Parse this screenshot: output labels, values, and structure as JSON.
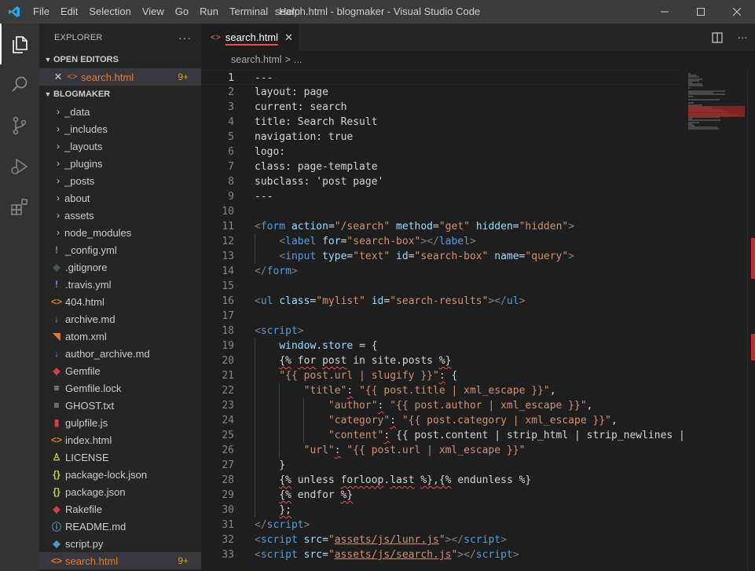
{
  "window": {
    "title": "search.html - blogmaker - Visual Studio Code",
    "menu": [
      "File",
      "Edit",
      "Selection",
      "View",
      "Go",
      "Run",
      "Terminal",
      "Help"
    ]
  },
  "sidebar": {
    "title": "EXPLORER",
    "more": "···",
    "open_editors_label": "OPEN EDITORS",
    "open_editor": {
      "name": "search.html",
      "badge": "9+"
    },
    "project_label": "BLOGMAKER",
    "folders": [
      "_data",
      "_includes",
      "_layouts",
      "_plugins",
      "_posts",
      "about",
      "assets",
      "node_modules"
    ],
    "files": [
      {
        "name": "_config.yml",
        "icon": "!",
        "color": "#a074c4"
      },
      {
        "name": ".gitignore",
        "icon": "◆",
        "color": "#41535b"
      },
      {
        "name": ".travis.yml",
        "icon": "!",
        "color": "#a074c4"
      },
      {
        "name": "404.html",
        "icon": "<>",
        "color": "#e37933"
      },
      {
        "name": "archive.md",
        "icon": "↓",
        "color": "#519aba"
      },
      {
        "name": "atom.xml",
        "icon": "◥",
        "color": "#e37933"
      },
      {
        "name": "author_archive.md",
        "icon": "↓",
        "color": "#519aba"
      },
      {
        "name": "Gemfile",
        "icon": "◆",
        "color": "#cc3e44"
      },
      {
        "name": "Gemfile.lock",
        "icon": "≡",
        "color": "#cccccc"
      },
      {
        "name": "GHOST.txt",
        "icon": "≡",
        "color": "#cccccc"
      },
      {
        "name": "gulpfile.js",
        "icon": "▮",
        "color": "#cc3e44"
      },
      {
        "name": "index.html",
        "icon": "<>",
        "color": "#e37933"
      },
      {
        "name": "LICENSE",
        "icon": "♙",
        "color": "#cbcb41"
      },
      {
        "name": "package-lock.json",
        "icon": "{}",
        "color": "#cbcb41"
      },
      {
        "name": "package.json",
        "icon": "{}",
        "color": "#cbcb41"
      },
      {
        "name": "Rakefile",
        "icon": "◆",
        "color": "#cc3e44"
      },
      {
        "name": "README.md",
        "icon": "ⓘ",
        "color": "#519aba"
      },
      {
        "name": "script.py",
        "icon": "◆",
        "color": "#519aba"
      },
      {
        "name": "search.html",
        "icon": "<>",
        "color": "#e37933",
        "badge": "9+",
        "selected": true
      }
    ]
  },
  "editor": {
    "tab_label": "search.html",
    "breadcrumb": [
      "search.html",
      "..."
    ],
    "breadcrumb_sep": ">",
    "active_line": 1,
    "lines": [
      [
        [
          "p",
          "---"
        ]
      ],
      [
        [
          "p",
          "layout: page"
        ]
      ],
      [
        [
          "p",
          "current: search"
        ]
      ],
      [
        [
          "p",
          "title: Search Result"
        ]
      ],
      [
        [
          "p",
          "navigation: true"
        ]
      ],
      [
        [
          "p",
          "logo:"
        ]
      ],
      [
        [
          "p",
          "class: page-template"
        ]
      ],
      [
        [
          "p",
          "subclass: 'post page'"
        ]
      ],
      [
        [
          "p",
          "---"
        ]
      ],
      [],
      [
        [
          "b",
          "<"
        ],
        [
          "t",
          "form"
        ],
        [
          "p",
          " "
        ],
        [
          "a",
          "action"
        ],
        [
          "p",
          "="
        ],
        [
          "s",
          "\"/search\""
        ],
        [
          "p",
          " "
        ],
        [
          "a",
          "method"
        ],
        [
          "p",
          "="
        ],
        [
          "s",
          "\"get\""
        ],
        [
          "p",
          " "
        ],
        [
          "a",
          "hidden"
        ],
        [
          "p",
          "="
        ],
        [
          "s",
          "\"hidden\""
        ],
        [
          "b",
          ">"
        ]
      ],
      [
        [
          "p",
          "    "
        ],
        [
          "b",
          "<"
        ],
        [
          "t",
          "label"
        ],
        [
          "p",
          " "
        ],
        [
          "a",
          "for"
        ],
        [
          "p",
          "="
        ],
        [
          "s",
          "\"search-box\""
        ],
        [
          "b",
          "></"
        ],
        [
          "t",
          "label"
        ],
        [
          "b",
          ">"
        ]
      ],
      [
        [
          "p",
          "    "
        ],
        [
          "b",
          "<"
        ],
        [
          "t",
          "input"
        ],
        [
          "p",
          " "
        ],
        [
          "a",
          "type"
        ],
        [
          "p",
          "="
        ],
        [
          "s",
          "\"text\""
        ],
        [
          "p",
          " "
        ],
        [
          "a",
          "id"
        ],
        [
          "p",
          "="
        ],
        [
          "s",
          "\"search-box\""
        ],
        [
          "p",
          " "
        ],
        [
          "a",
          "name"
        ],
        [
          "p",
          "="
        ],
        [
          "s",
          "\"query\""
        ],
        [
          "b",
          ">"
        ]
      ],
      [
        [
          "b",
          "</"
        ],
        [
          "t",
          "form"
        ],
        [
          "b",
          ">"
        ]
      ],
      [],
      [
        [
          "b",
          "<"
        ],
        [
          "t",
          "ul"
        ],
        [
          "p",
          " "
        ],
        [
          "a",
          "class"
        ],
        [
          "p",
          "="
        ],
        [
          "s",
          "\"mylist\""
        ],
        [
          "p",
          " "
        ],
        [
          "a",
          "id"
        ],
        [
          "p",
          "="
        ],
        [
          "s",
          "\"search-results\""
        ],
        [
          "b",
          "></"
        ],
        [
          "t",
          "ul"
        ],
        [
          "b",
          ">"
        ]
      ],
      [],
      [
        [
          "b",
          "<"
        ],
        [
          "t",
          "script"
        ],
        [
          "b",
          ">"
        ]
      ],
      [
        [
          "p",
          "    "
        ],
        [
          "a",
          "window"
        ],
        [
          "p",
          "."
        ],
        [
          "a",
          "store"
        ],
        [
          "p",
          " = {"
        ]
      ],
      [
        [
          "p",
          "    "
        ],
        [
          "q",
          "{%"
        ],
        [
          "p",
          " "
        ],
        [
          "q",
          "for"
        ],
        [
          "p",
          " "
        ],
        [
          "q",
          "post"
        ],
        [
          "p",
          " in site.posts "
        ],
        [
          "q",
          "%}"
        ]
      ],
      [
        [
          "p",
          "    "
        ],
        [
          "s",
          "\"{{ post.url | slugify }}\""
        ],
        [
          "q",
          ":"
        ],
        [
          "p",
          " {"
        ]
      ],
      [
        [
          "p",
          "        "
        ],
        [
          "s",
          "\"title\""
        ],
        [
          "q",
          ":"
        ],
        [
          "p",
          " "
        ],
        [
          "s",
          "\"{{ post.title | xml_escape }}\""
        ],
        [
          "p",
          ","
        ]
      ],
      [
        [
          "p",
          "            "
        ],
        [
          "s",
          "\"author\""
        ],
        [
          "q",
          ":"
        ],
        [
          "p",
          " "
        ],
        [
          "s",
          "\"{{ post.author | xml_escape }}\""
        ],
        [
          "p",
          ","
        ]
      ],
      [
        [
          "p",
          "            "
        ],
        [
          "s",
          "\"category\""
        ],
        [
          "q",
          ":"
        ],
        [
          "p",
          " "
        ],
        [
          "s",
          "\"{{ post.category | xml_escape }}\""
        ],
        [
          "p",
          ","
        ]
      ],
      [
        [
          "p",
          "            "
        ],
        [
          "s",
          "\"content\""
        ],
        [
          "q",
          ":"
        ],
        [
          "p",
          " {{ post.content | strip_html | strip_newlines | "
        ]
      ],
      [
        [
          "p",
          "        "
        ],
        [
          "s",
          "\"url\""
        ],
        [
          "q",
          ":"
        ],
        [
          "p",
          " "
        ],
        [
          "s",
          "\"{{ post.url | xml_escape }}\""
        ]
      ],
      [
        [
          "p",
          "    }"
        ]
      ],
      [
        [
          "p",
          "    "
        ],
        [
          "q",
          "{%"
        ],
        [
          "p",
          " unless "
        ],
        [
          "q",
          "forloop"
        ],
        [
          "p",
          "."
        ],
        [
          "q",
          "last"
        ],
        [
          "p",
          " "
        ],
        [
          "q",
          "%}"
        ],
        [
          "q",
          ","
        ],
        [
          "q",
          "{%"
        ],
        [
          "p",
          " endunless %}"
        ]
      ],
      [
        [
          "p",
          "    "
        ],
        [
          "q",
          "{%"
        ],
        [
          "p",
          " endfor "
        ],
        [
          "q",
          "%}"
        ]
      ],
      [
        [
          "p",
          "    "
        ],
        [
          "q",
          "};"
        ]
      ],
      [
        [
          "b",
          "</"
        ],
        [
          "t",
          "script"
        ],
        [
          "b",
          ">"
        ]
      ],
      [
        [
          "b",
          "<"
        ],
        [
          "t",
          "script"
        ],
        [
          "p",
          " "
        ],
        [
          "a",
          "src"
        ],
        [
          "p",
          "="
        ],
        [
          "s",
          "\""
        ],
        [
          "l",
          "assets/js/lunr.js"
        ],
        [
          "s",
          "\""
        ],
        [
          "b",
          "></"
        ],
        [
          "t",
          "script"
        ],
        [
          "b",
          ">"
        ]
      ],
      [
        [
          "b",
          "<"
        ],
        [
          "t",
          "script"
        ],
        [
          "p",
          " "
        ],
        [
          "a",
          "src"
        ],
        [
          "p",
          "="
        ],
        [
          "s",
          "\""
        ],
        [
          "l",
          "assets/js/search.js"
        ],
        [
          "s",
          "\""
        ],
        [
          "b",
          "></"
        ],
        [
          "t",
          "script"
        ],
        [
          "b",
          ">"
        ]
      ]
    ]
  },
  "colors": {
    "accent": "#007acc",
    "error": "#f14c4c",
    "warning_badge": "#cca700",
    "html_icon": "#e37933"
  }
}
